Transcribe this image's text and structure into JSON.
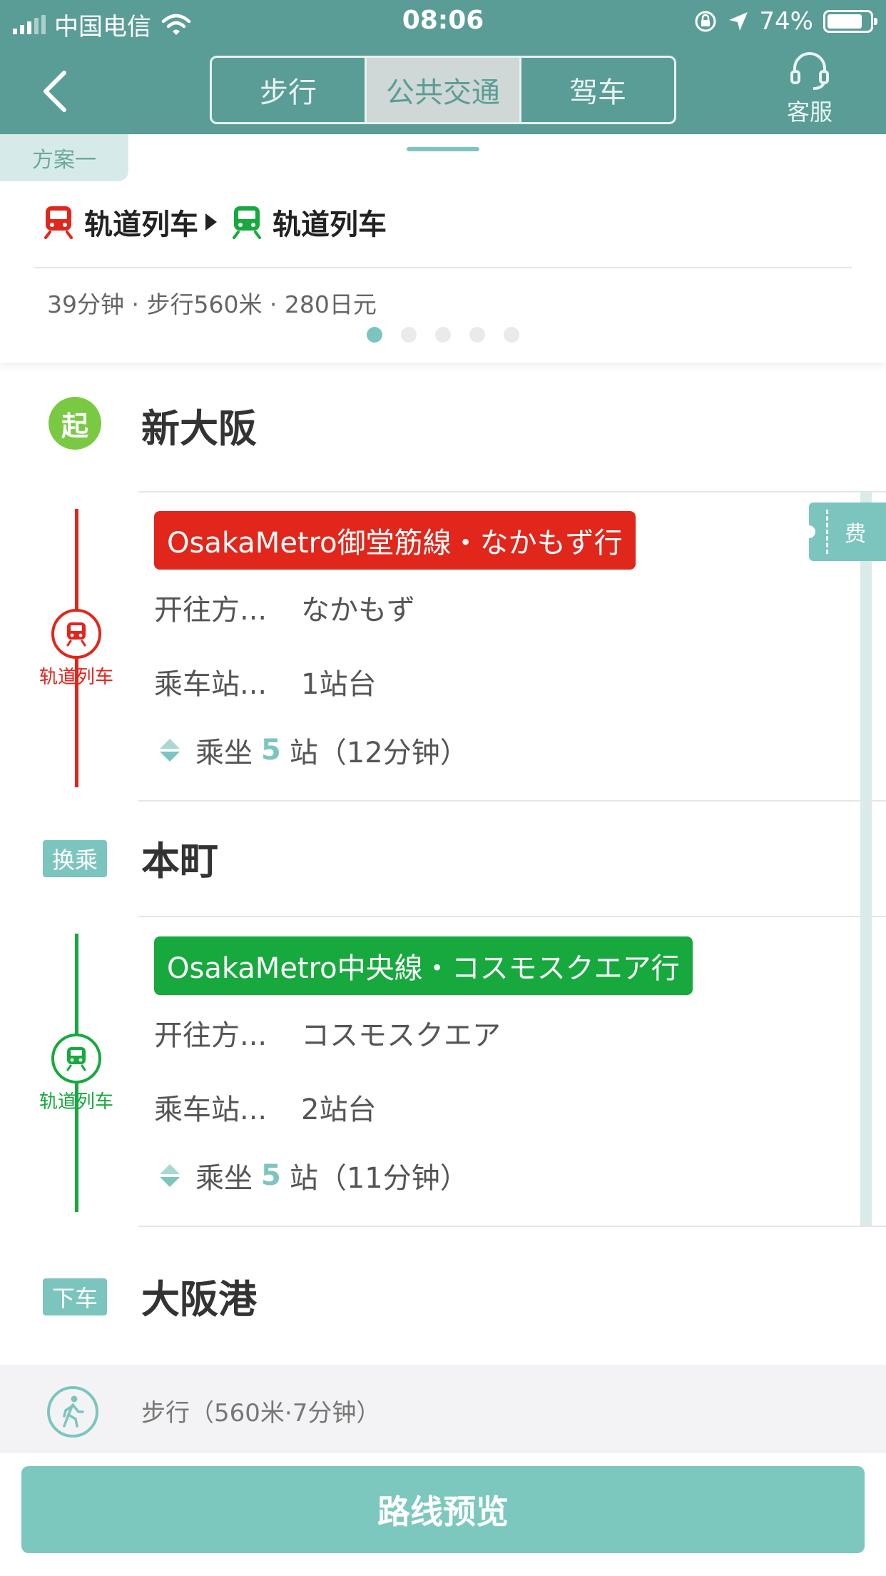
{
  "status_bar": {
    "carrier": "中国电信",
    "time": "08:06",
    "battery": "74%"
  },
  "header": {
    "tabs": [
      {
        "label": "步行",
        "active": false
      },
      {
        "label": "公共交通",
        "active": true
      },
      {
        "label": "驾车",
        "active": false
      }
    ],
    "service_label": "客服",
    "accent_color": "#5a9d96"
  },
  "plan": {
    "tag": "方案一",
    "modes": [
      "轨道列车",
      "轨道列车"
    ],
    "summary": "39分钟 · 步行560米 · 280日元",
    "page_count": 5,
    "active_page": 0
  },
  "route": {
    "start_badge": "起",
    "start_station": "新大阪",
    "fee_label": "费",
    "legs": [
      {
        "mode_label": "轨道列车",
        "line_name": "OsakaMetro御堂筋線・なかもず行",
        "color": "#e1261c",
        "direction_key": "开往方...",
        "direction_value": "なかもず",
        "platform_key": "乘车站...",
        "platform_value": "1站台",
        "ride_prefix": "乘坐",
        "ride_stops": "5",
        "ride_suffix": "站（12分钟）"
      },
      {
        "mode_label": "轨道列车",
        "line_name": "OsakaMetro中央線・コスモスクエア行",
        "color": "#17a93e",
        "direction_key": "开往方...",
        "direction_value": "コスモスクエア",
        "platform_key": "乘车站...",
        "platform_value": "2站台",
        "ride_prefix": "乘坐",
        "ride_stops": "5",
        "ride_suffix": "站（11分钟）"
      }
    ],
    "transfer_badge": "换乘",
    "transfer_station": "本町",
    "end_badge": "下车",
    "end_station": "大阪港",
    "walk_text": "步行（560米·7分钟）"
  },
  "bottom": {
    "preview_label": "路线预览"
  }
}
